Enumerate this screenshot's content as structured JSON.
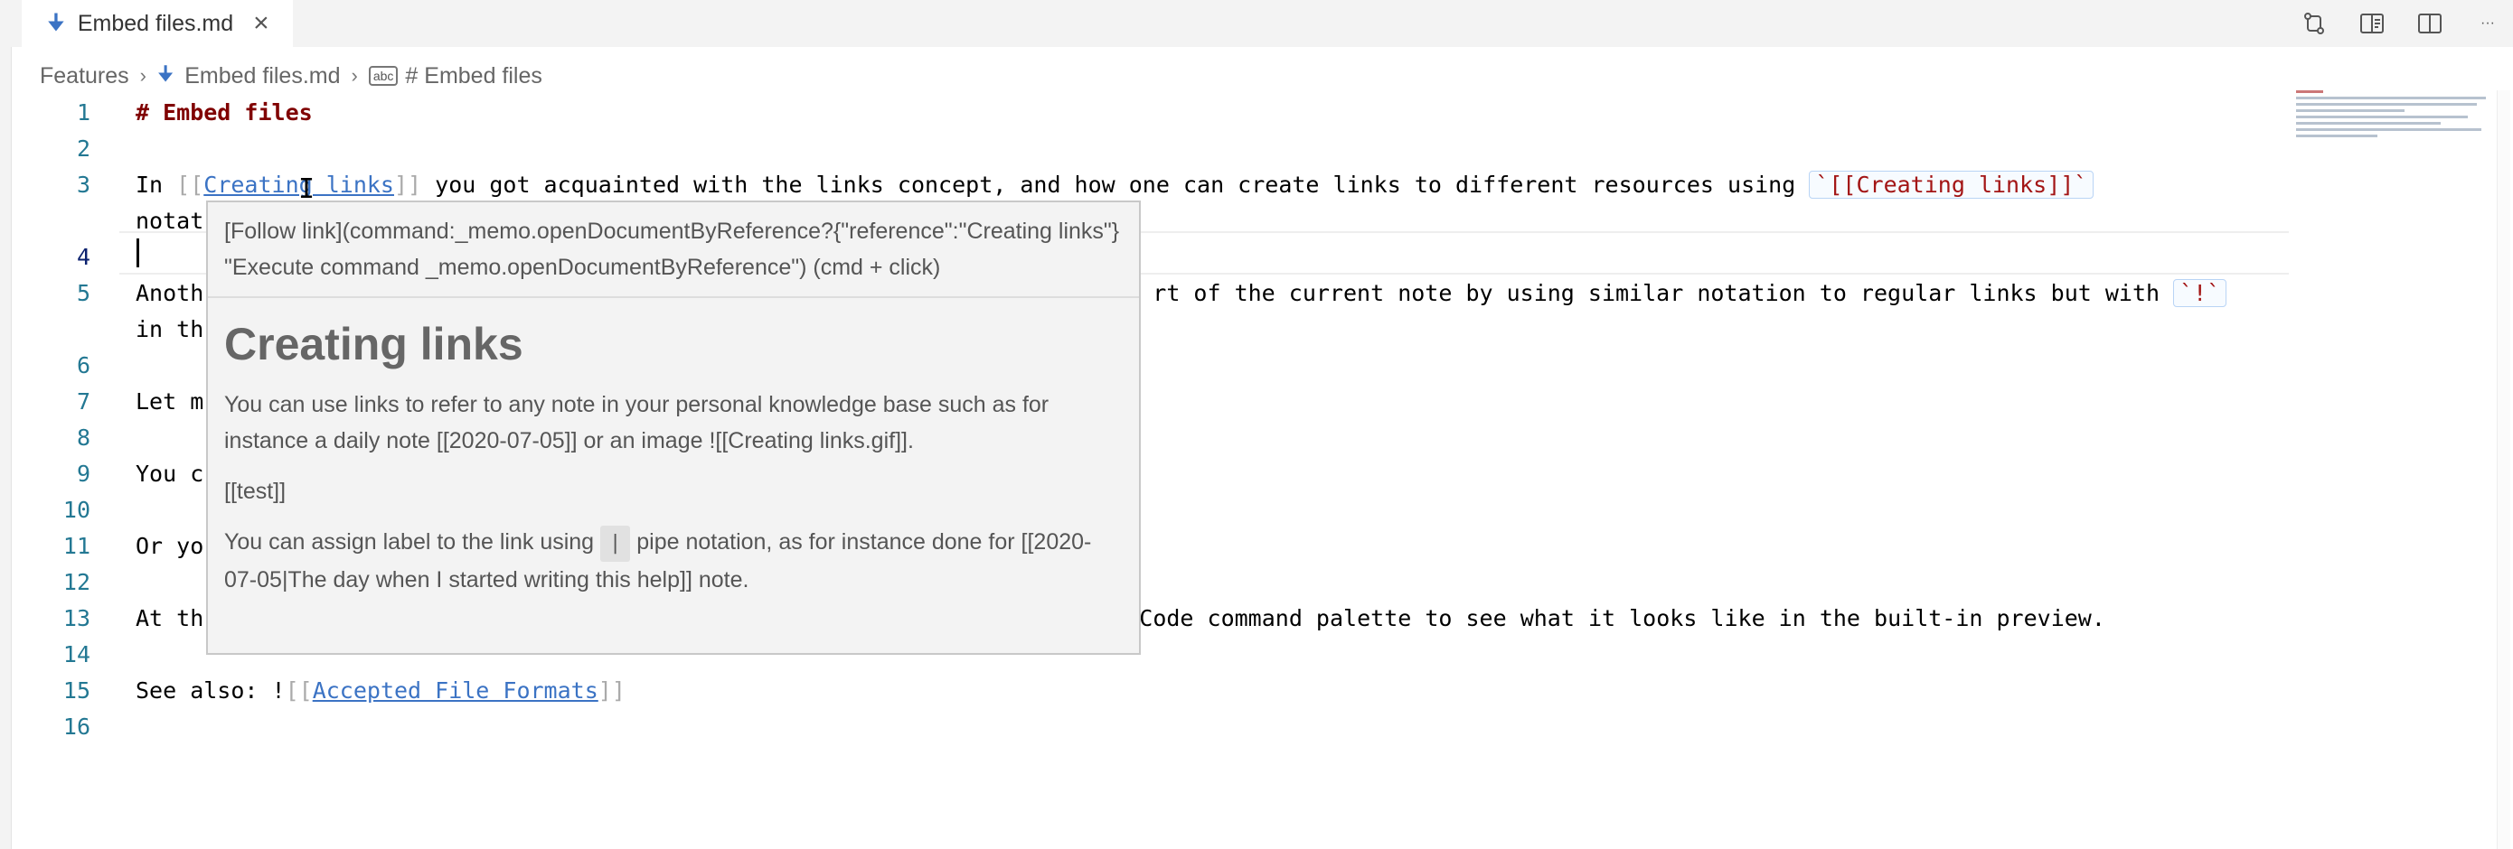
{
  "tab": {
    "icon": "markdown-down-arrow-icon",
    "label": "Embed files.md",
    "close_icon": "close-icon"
  },
  "actions": [
    {
      "name": "open-changes-icon"
    },
    {
      "name": "open-preview-to-side-icon"
    },
    {
      "name": "split-editor-icon"
    },
    {
      "name": "more-actions-icon",
      "glyph": "···"
    }
  ],
  "breadcrumb": {
    "folder": "Features",
    "file": "Embed files.md",
    "symbol": "# Embed files",
    "symbol_icon": "abc"
  },
  "editor": {
    "lines": [
      {
        "n": "1",
        "text": "# Embed files"
      },
      {
        "n": "2",
        "text": ""
      },
      {
        "n": "3",
        "pre": "In ",
        "link": "Creating links",
        "mid": " you got acquainted with the links concept, and how one can create links to different resources using ",
        "code": "`[[Creating links]]`"
      },
      {
        "n": "",
        "text": "notat"
      },
      {
        "n": "4",
        "text": ""
      },
      {
        "n": "5",
        "pre": "Anoth",
        "tail": "rt of the current note by using similar notation to regular links but with ",
        "code": "`!`"
      },
      {
        "n": "",
        "text": "in th"
      },
      {
        "n": "6",
        "text": ""
      },
      {
        "n": "7",
        "text": "Let m"
      },
      {
        "n": "8",
        "text": ""
      },
      {
        "n": "9",
        "text": "You c"
      },
      {
        "n": "10",
        "text": ""
      },
      {
        "n": "11",
        "text": "Or yo"
      },
      {
        "n": "12",
        "text": ""
      },
      {
        "n": "13",
        "pre": "At th",
        "tail": "Code command palette to see what it looks like in the built-in preview."
      },
      {
        "n": "14",
        "text": ""
      },
      {
        "n": "15",
        "pre": "See also: !",
        "link": "Accepted File Formats"
      },
      {
        "n": "16",
        "text": ""
      }
    ]
  },
  "hover": {
    "command": "[Follow link](command:_memo.openDocumentByReference?{\"reference\":\"Creating links\"} \"Execute command _memo.openDocumentByReference\") (cmd + click)",
    "title": "Creating links",
    "p1": "You can use links to refer to any note in your personal knowledge base such as for instance a daily note [[2020-07-05]] or an image ![[Creating links.gif]].",
    "p2": "[[test]]",
    "p3_pre": "You can assign label to the link using",
    "p3_pipe": "|",
    "p3_post": "pipe notation, as for instance done for [[2020-07-05|The day when I started writing this help]] note."
  },
  "colors": {
    "link": "#3b73c4",
    "heading": "#800000",
    "code": "#a31515",
    "line_number": "#237893"
  }
}
